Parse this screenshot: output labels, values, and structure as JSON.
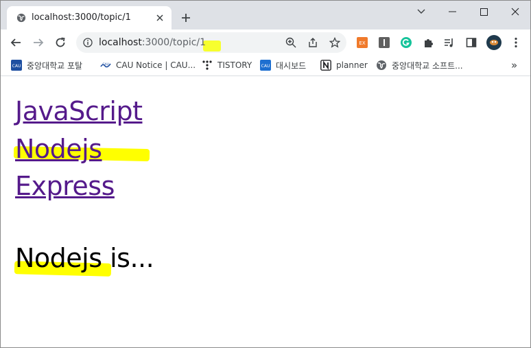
{
  "tab": {
    "title": "localhost:3000/topic/1",
    "favicon": "globe-icon"
  },
  "toolbar": {
    "url_host": "localhost",
    "url_path": ":3000/topic/1",
    "icons": [
      "back-icon",
      "forward-icon",
      "reload-icon",
      "info-icon",
      "zoom-icon",
      "share-icon",
      "star-icon"
    ]
  },
  "extensions": [
    "ex-extension-icon",
    "i-extension-icon",
    "grammarly-icon",
    "puzzle-icon",
    "media-control-icon",
    "side-panel-icon",
    "profile-avatar",
    "menu-icon"
  ],
  "bookmarks": [
    {
      "label": "중앙대학교 포탈",
      "icon": "cau-icon"
    },
    {
      "label": "CAU Notice | CAU...",
      "icon": "cau-wave-icon"
    },
    {
      "label": "TISTORY",
      "icon": "tistory-icon"
    },
    {
      "label": "대시보드",
      "icon": "cau-icon"
    },
    {
      "label": "planner",
      "icon": "notion-icon"
    },
    {
      "label": "중앙대학교 소프트...",
      "icon": "globe-icon"
    }
  ],
  "bookmarks_overflow": "»",
  "page": {
    "links": [
      "JavaScript",
      "Nodejs",
      "Express"
    ],
    "heading": "Nodejs is..."
  },
  "colors": {
    "link": "#551a8b",
    "highlight": "#ffff00",
    "tabstrip": "#dee1e6"
  }
}
